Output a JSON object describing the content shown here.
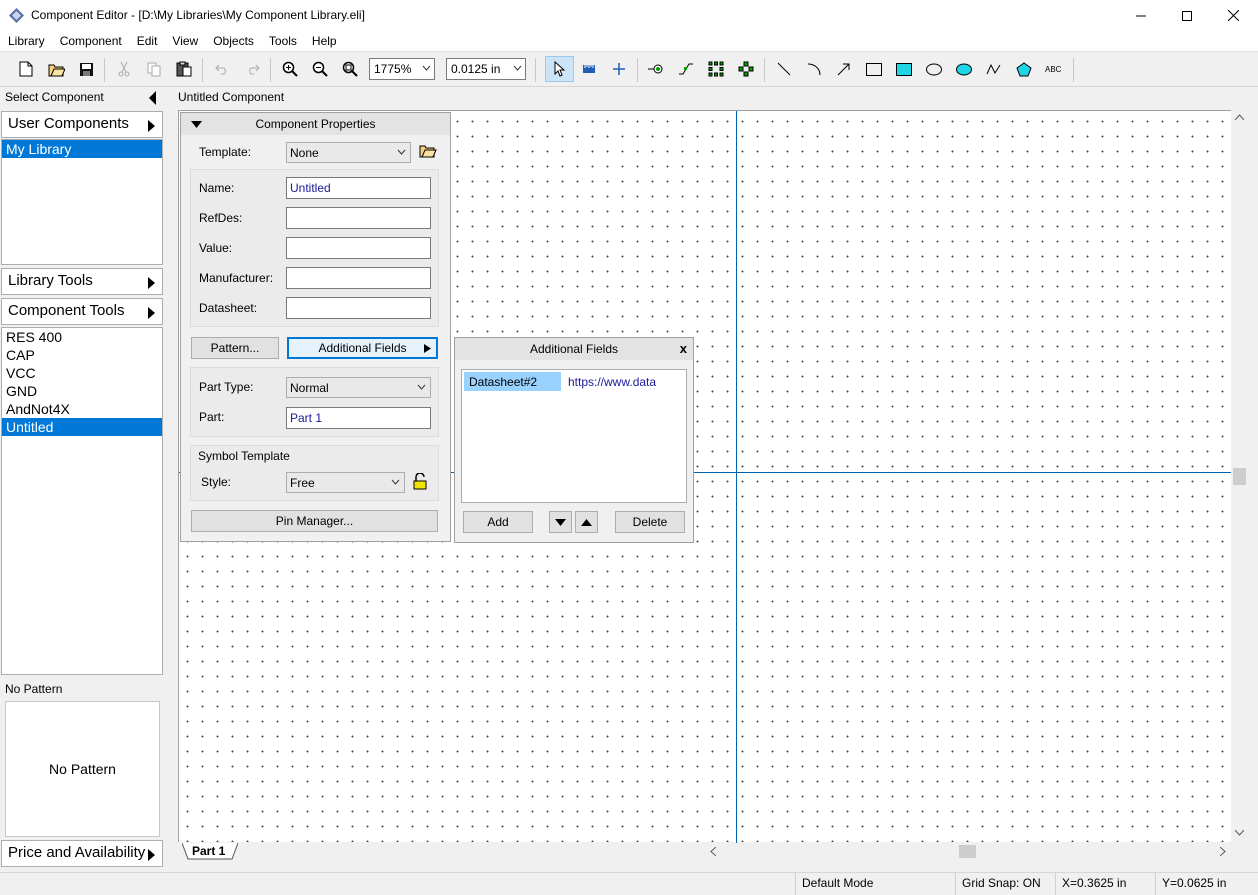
{
  "window": {
    "title": "Component Editor - [D:\\My Libraries\\My Component Library.eli]",
    "icon": "app-diamond-icon"
  },
  "menu": [
    "Library",
    "Component",
    "Edit",
    "View",
    "Objects",
    "Tools",
    "Help"
  ],
  "toolbar": {
    "zoom_value": "1775%",
    "grid_value": "0.0125 in",
    "icons": [
      "new-icon",
      "open-icon",
      "save-icon",
      "cut-icon",
      "copy-icon",
      "paste-icon",
      "undo-icon",
      "redo-icon",
      "zoom-in-icon",
      "zoom-out-icon",
      "zoom-fit-icon",
      "select-arrow-icon",
      "ruler-icon",
      "crosshair-icon",
      "pin-icon",
      "net-icon",
      "pin-array-icon",
      "pin-group-icon",
      "line-icon",
      "arc-icon",
      "arrow-icon",
      "rectangle-icon",
      "filled-rectangle-icon",
      "ellipse-icon",
      "filled-ellipse-icon",
      "polyline-icon",
      "polygon-icon",
      "text-icon"
    ]
  },
  "left_panel": {
    "select_component": "Select Component",
    "user_components": "User Components",
    "libraries": [
      {
        "label": "My Library",
        "selected": true
      }
    ],
    "library_tools": "Library Tools",
    "component_tools": "Component Tools",
    "components": [
      {
        "label": "RES 400",
        "selected": false
      },
      {
        "label": "CAP",
        "selected": false
      },
      {
        "label": "VCC",
        "selected": false
      },
      {
        "label": "GND",
        "selected": false
      },
      {
        "label": "AndNot4X",
        "selected": false
      },
      {
        "label": "Untitled",
        "selected": true
      }
    ],
    "pattern_header": "No Pattern",
    "pattern_preview": "No Pattern",
    "price_and_availability": "Price and Availability"
  },
  "canvas": {
    "title": "Untitled Component",
    "tab": "Part 1"
  },
  "component_properties": {
    "header": "Component Properties",
    "template_label": "Template:",
    "template_value": "None",
    "name_label": "Name:",
    "name_value": "Untitled",
    "refdes_label": "RefDes:",
    "refdes_value": "",
    "value_label": "Value:",
    "value_value": "",
    "manufacturer_label": "Manufacturer:",
    "manufacturer_value": "",
    "datasheet_label": "Datasheet:",
    "datasheet_value": "",
    "pattern_button": "Pattern...",
    "additional_fields_button": "Additional Fields",
    "part_type_label": "Part Type:",
    "part_type_value": "Normal",
    "part_label": "Part:",
    "part_value": "Part 1",
    "symbol_template_label": "Symbol Template",
    "style_label": "Style:",
    "style_value": "Free",
    "pin_manager_button": "Pin Manager..."
  },
  "additional_fields": {
    "header": "Additional Fields",
    "close": "x",
    "rows": [
      {
        "name": "Datasheet#2",
        "value": "https://www.data"
      }
    ],
    "add_button": "Add",
    "delete_button": "Delete"
  },
  "status": {
    "mode": "Default Mode",
    "grid_snap": "Grid Snap: ON",
    "x": "X=0.3625 in",
    "y": "Y=0.0625 in"
  }
}
